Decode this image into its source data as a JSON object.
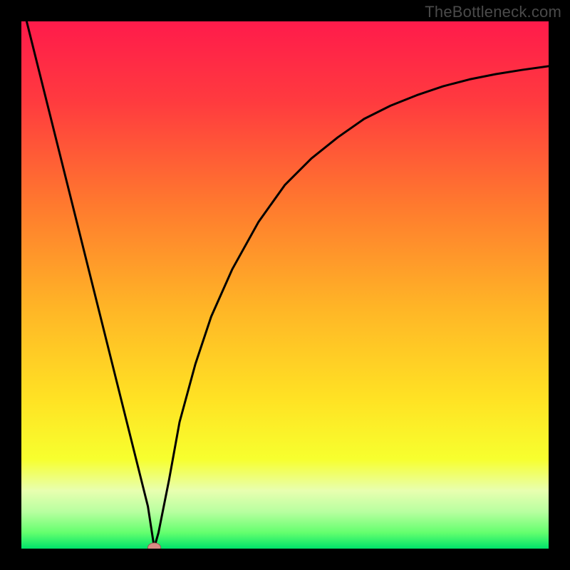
{
  "watermark": "TheBottleneck.com",
  "colors": {
    "frame": "#000000",
    "watermark_text": "#4a4a4a",
    "curve": "#000000",
    "marker_fill": "#d98d85",
    "marker_stroke": "#a05a55",
    "gradient_stops": [
      {
        "offset": 0,
        "color": "#ff1b4b"
      },
      {
        "offset": 15,
        "color": "#ff3a3f"
      },
      {
        "offset": 35,
        "color": "#ff7a2e"
      },
      {
        "offset": 55,
        "color": "#ffb726"
      },
      {
        "offset": 72,
        "color": "#ffe324"
      },
      {
        "offset": 83,
        "color": "#f7ff2e"
      },
      {
        "offset": 89,
        "color": "#e8ffb0"
      },
      {
        "offset": 93,
        "color": "#b8ffa0"
      },
      {
        "offset": 97,
        "color": "#63ff6e"
      },
      {
        "offset": 100,
        "color": "#00e26a"
      }
    ]
  },
  "chart_data": {
    "type": "line",
    "title": "",
    "xlabel": "",
    "ylabel": "",
    "xlim": [
      0,
      100
    ],
    "ylim": [
      0,
      100
    ],
    "legend": false,
    "grid": false,
    "series": [
      {
        "name": "curve",
        "x": [
          1,
          5,
          10,
          15,
          18,
          21,
          24,
          25.2,
          26,
          28,
          30,
          33,
          36,
          40,
          45,
          50,
          55,
          60,
          65,
          70,
          75,
          80,
          85,
          90,
          95,
          100
        ],
        "y": [
          100,
          84,
          64,
          44,
          32,
          20,
          8,
          0.2,
          3,
          13,
          24,
          35,
          44,
          53,
          62,
          69,
          74,
          78,
          81.5,
          84,
          86,
          87.7,
          89,
          90,
          90.8,
          91.5
        ]
      }
    ],
    "marker": {
      "x": 25.2,
      "y": 0.2
    }
  }
}
